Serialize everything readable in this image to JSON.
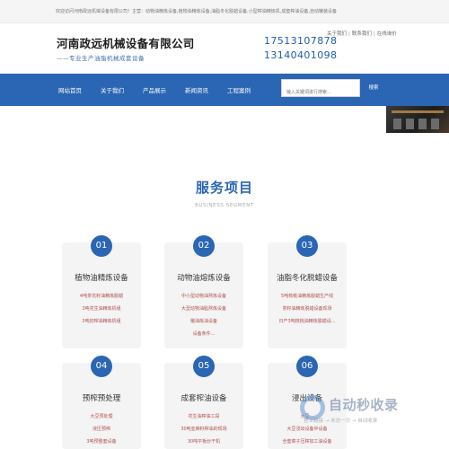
{
  "topbar": {
    "text": "欢迎访问河南政远机械设备有限公司！主营：动物油精炼设备,植物油精炼设备,油脂冬化脱蜡设备,小型榨油精炼机,成套榨油设备,自动罐装设备"
  },
  "header": {
    "company": "河南政远机械设备有限公司",
    "slogan": "——专业生产油脂机械成套设备",
    "phones": [
      "17513107878",
      "13140401098"
    ],
    "links": [
      "关于我们",
      "联系我们",
      "在线询价"
    ]
  },
  "nav": {
    "items": [
      "网站首页",
      "关于我们",
      "产品展示",
      "新闻资讯",
      "工程案例"
    ],
    "search_placeholder": "输入关键词进行搜索...",
    "search_button": "搜索"
  },
  "services": {
    "title": "服务项目",
    "subtitle": "BUSINESS SEGMENT",
    "cards": [
      {
        "num": "01",
        "title": "植物油精炼设备",
        "lines": [
          "4吨茶花籽油精炼脱蜡",
          "3吨花生油精炼机组",
          "3吨初榨油精炼机组"
        ]
      },
      {
        "num": "02",
        "title": "动物油熔炼设备",
        "lines": [
          "中小型动物油熬炼设备",
          "大型动物油脂熬炼设备",
          "猪油炼油设备",
          "设备条件..."
        ]
      },
      {
        "num": "03",
        "title": "油脂冬化脱蜡设备",
        "lines": [
          "5吨核桃油精炼脱蜡生产线",
          "茶籽油精炼脱蜡设备现场",
          "日产3吨核桃油精炼脱蜡设..."
        ]
      },
      {
        "num": "04",
        "title": "预榨预处理",
        "lines": [
          "大豆预处理",
          "液压预榨",
          "3吨预整套设备"
        ]
      },
      {
        "num": "05",
        "title": "成套榨油设备",
        "lines": [
          "花生油榨油工段",
          "30吨亚麻籽榨油的现场",
          "30吨平板炒干机"
        ]
      },
      {
        "num": "06",
        "title": "浸出设备",
        "lines": [
          "大豆...",
          "大豆浸出设备中设备",
          "全套菜子压榨加工油设备"
        ]
      }
    ]
  },
  "watermark": {
    "text": "自动秒收录",
    "sub": "登上链接 → 未访一次 → 自动收录"
  },
  "colors": {
    "brand": "#2a66b3",
    "accent_text": "#b05050"
  }
}
